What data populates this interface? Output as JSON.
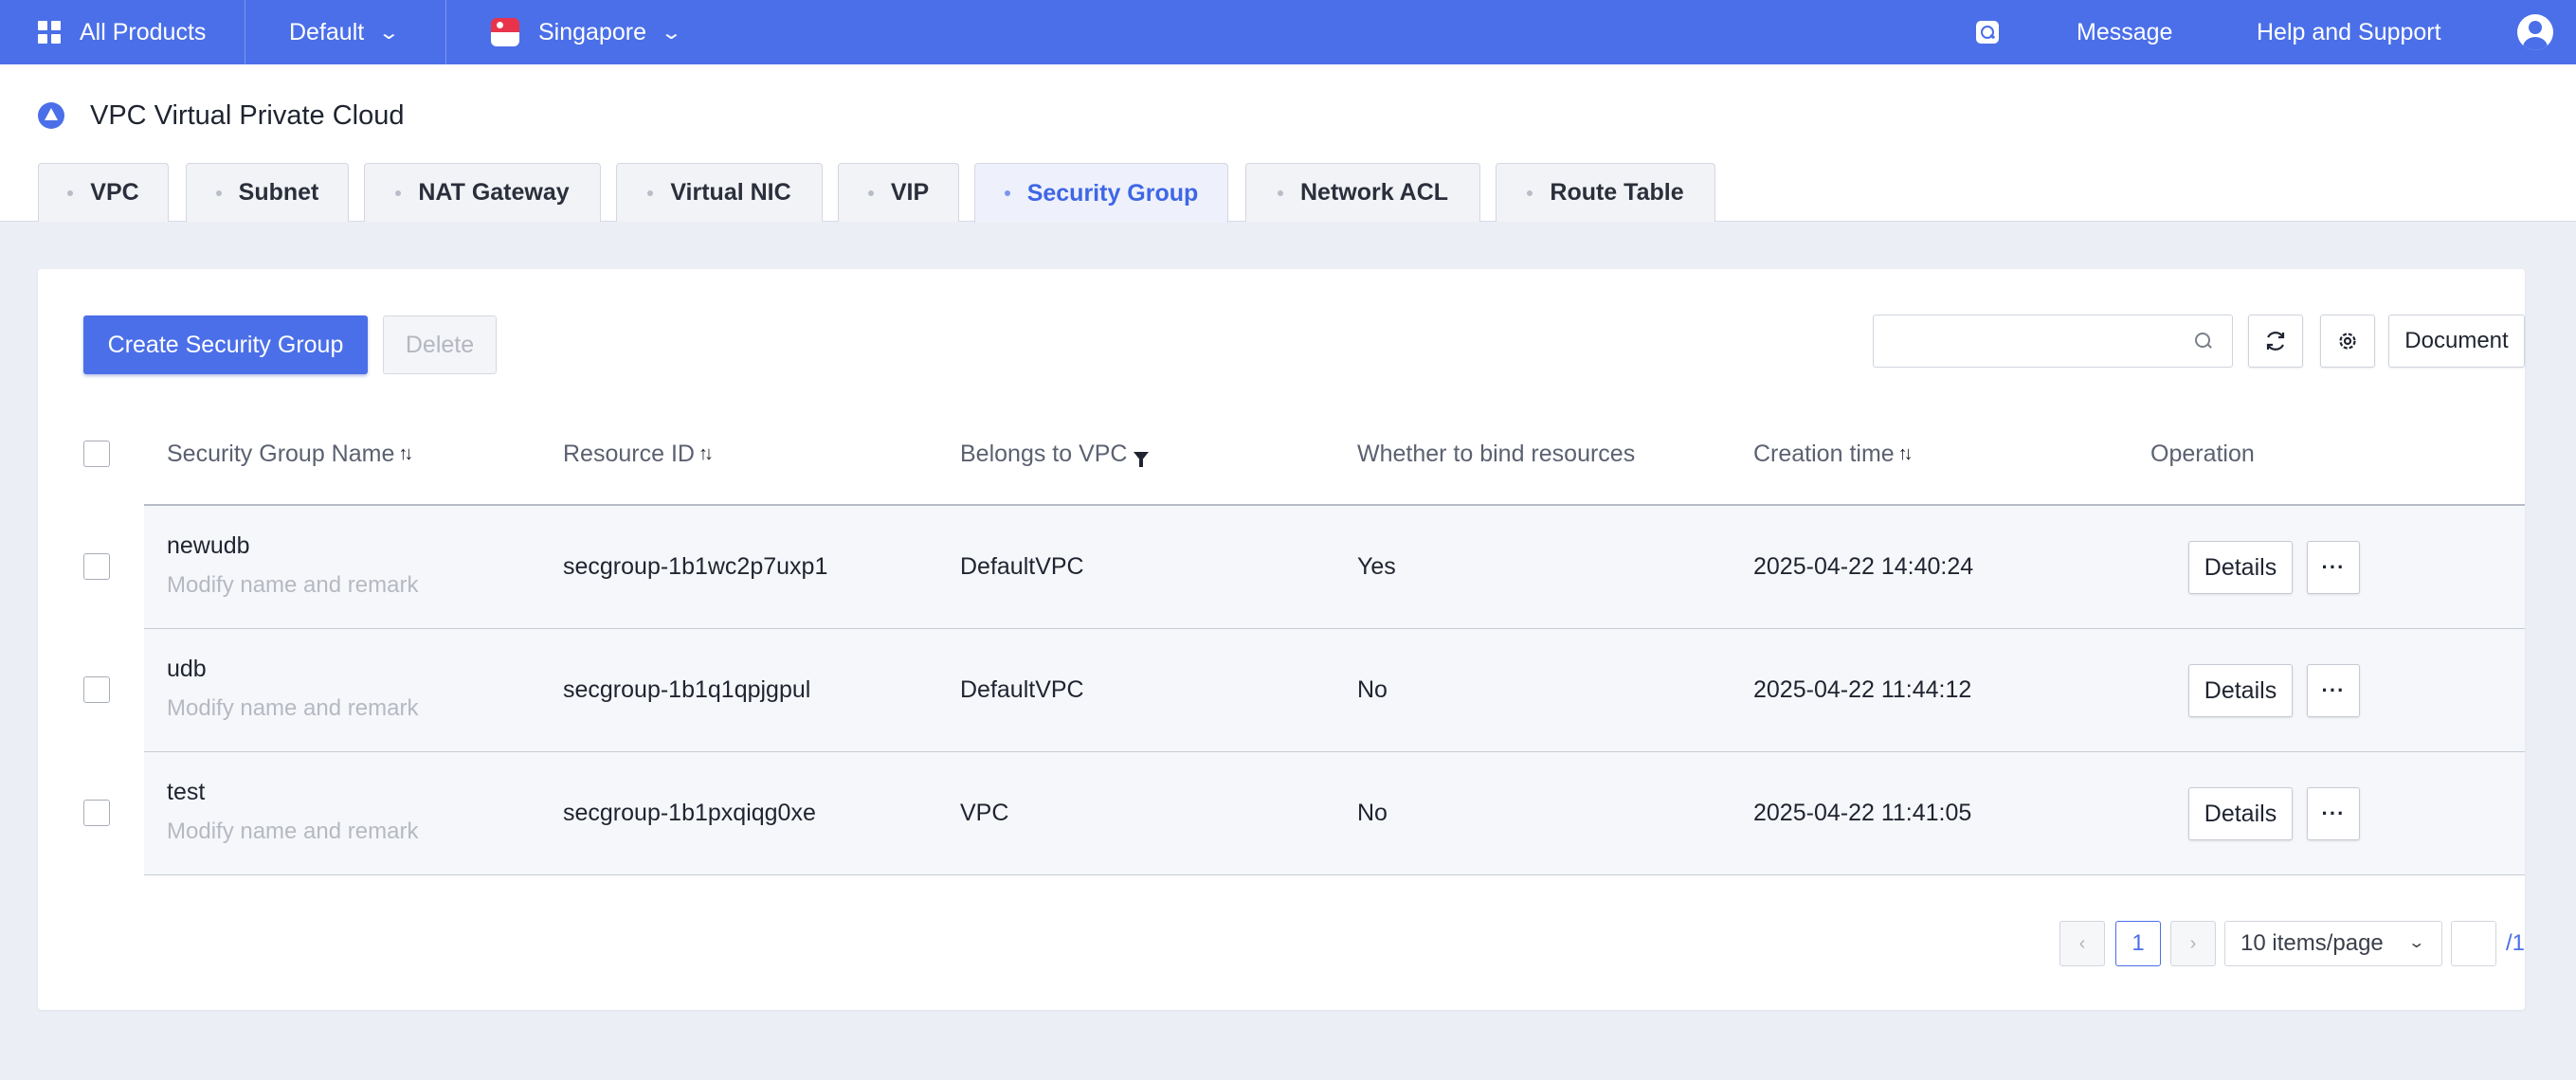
{
  "topbar": {
    "all_products": "All Products",
    "project": "Default",
    "region": "Singapore",
    "message": "Message",
    "help": "Help and Support",
    "accent": "#4b6fe8"
  },
  "page": {
    "title": "VPC Virtual Private Cloud"
  },
  "tabs": [
    {
      "label": "VPC",
      "active": false
    },
    {
      "label": "Subnet",
      "active": false
    },
    {
      "label": "NAT Gateway",
      "active": false
    },
    {
      "label": "Virtual NIC",
      "active": false
    },
    {
      "label": "VIP",
      "active": false
    },
    {
      "label": "Security Group",
      "active": true
    },
    {
      "label": "Network ACL",
      "active": false
    },
    {
      "label": "Route Table",
      "active": false
    }
  ],
  "toolbar": {
    "create_label": "Create Security Group",
    "delete_label": "Delete",
    "search_placeholder": "",
    "document_label": "Document",
    "icons": [
      "refresh-icon",
      "settings-icon",
      "search-icon"
    ]
  },
  "table": {
    "columns": [
      "Security Group Name",
      "Resource ID",
      "Belongs to VPC",
      "Whether to bind resources",
      "Creation time",
      "Operation"
    ],
    "rows": [
      {
        "name": "newudb",
        "remark": "Modify name and remark",
        "resource_id": "secgroup-1b1wc2p7uxp1",
        "vpc": "DefaultVPC",
        "bound": "Yes",
        "created": "2025-04-22 14:40:24",
        "details": "Details",
        "more": "···"
      },
      {
        "name": "udb",
        "remark": "Modify name and remark",
        "resource_id": "secgroup-1b1q1qpjgpul",
        "vpc": "DefaultVPC",
        "bound": "No",
        "created": "2025-04-22 11:44:12",
        "details": "Details",
        "more": "···"
      },
      {
        "name": "test",
        "remark": "Modify name and remark",
        "resource_id": "secgroup-1b1pxqiqg0xe",
        "vpc": "VPC",
        "bound": "No",
        "created": "2025-04-22 11:41:05",
        "details": "Details",
        "more": "···"
      }
    ]
  },
  "pagination": {
    "prev": "‹",
    "next": "›",
    "current_page": "1",
    "page_size": "10 items/page",
    "total_pages": "/1"
  }
}
